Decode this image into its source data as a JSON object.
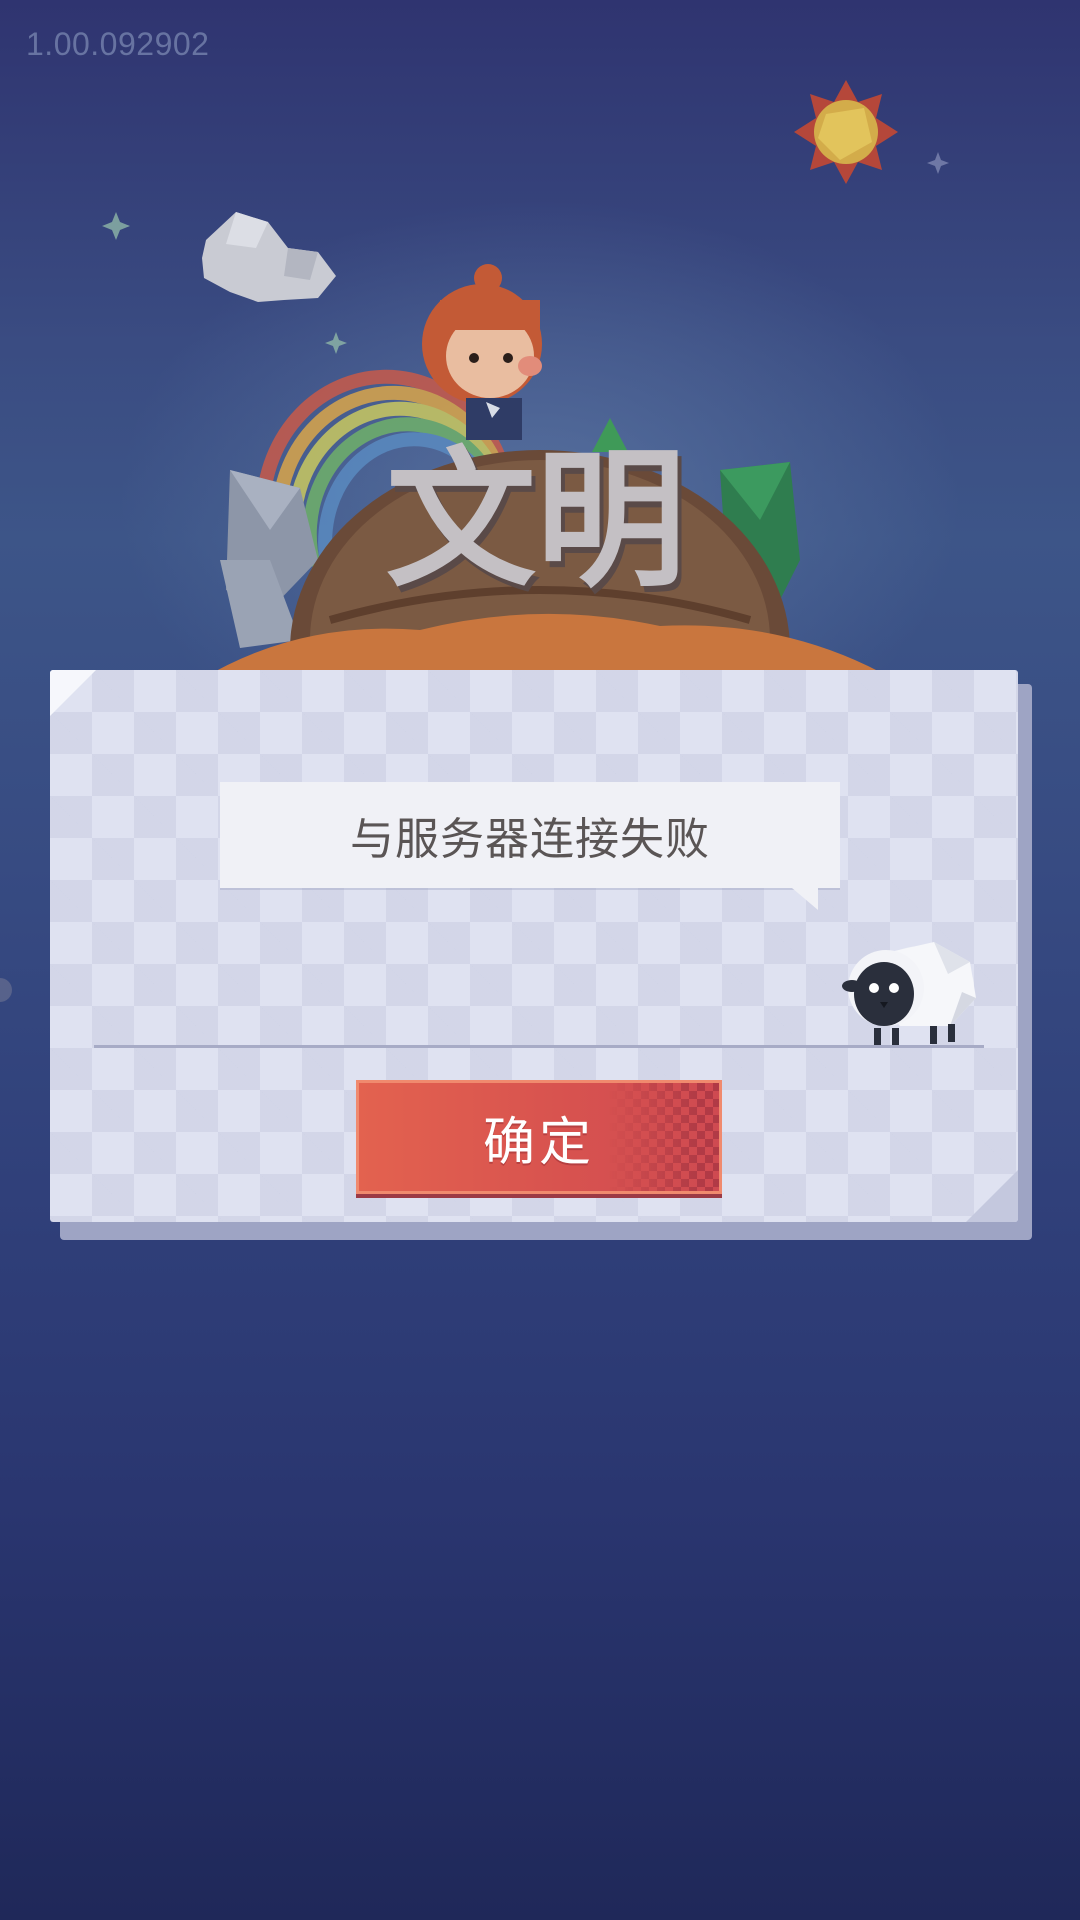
{
  "version": "1.00.092902",
  "background": {
    "logo_title": "文明",
    "logo_icon": "game-logo-icon",
    "colors": {
      "sky_top": "#2f3470",
      "sky_bottom": "#1f2859"
    }
  },
  "dialog": {
    "message": "与服务器连接失败",
    "confirm_label": "确定",
    "mascot_icon": "sheep-icon",
    "colors": {
      "paper": "#dfe2f1",
      "button": "#d8534f",
      "message_text": "#5a5555"
    }
  }
}
